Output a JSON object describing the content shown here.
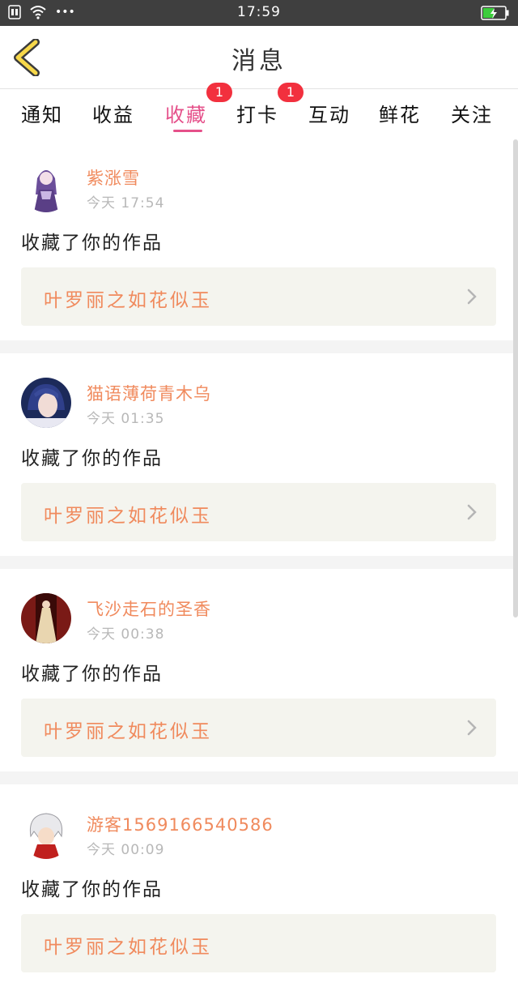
{
  "status_bar": {
    "time": "17:59",
    "dots": "•••"
  },
  "header": {
    "title": "消息"
  },
  "tabs": [
    {
      "label": "通知",
      "active": false,
      "badge": null
    },
    {
      "label": "收益",
      "active": false,
      "badge": null
    },
    {
      "label": "收藏",
      "active": true,
      "badge": "1"
    },
    {
      "label": "打卡",
      "active": false,
      "badge": "1"
    },
    {
      "label": "互动",
      "active": false,
      "badge": null
    },
    {
      "label": "鲜花",
      "active": false,
      "badge": null
    },
    {
      "label": "关注",
      "active": false,
      "badge": null
    }
  ],
  "feed": [
    {
      "user": "紫涨雪",
      "time": "今天 17:54",
      "action": "收藏了你的作品",
      "work": "叶罗丽之如花似玉",
      "avatar": "purple-doll-avatar"
    },
    {
      "user": "猫语薄荷青木乌",
      "time": "今天 01:35",
      "action": "收藏了你的作品",
      "work": "叶罗丽之如花似玉",
      "avatar": "blue-hair-avatar"
    },
    {
      "user": "飞沙走石的圣香",
      "time": "今天 00:38",
      "action": "收藏了你的作品",
      "work": "叶罗丽之如花似玉",
      "avatar": "gown-avatar"
    },
    {
      "user": "游客1569166540586",
      "time": "今天 00:09",
      "action": "收藏了你的作品",
      "work": "叶罗丽之如花似玉",
      "avatar": "white-hair-avatar"
    }
  ],
  "colors": {
    "accent": "#e5508a",
    "name": "#f08a5d",
    "badge": "#f2303e",
    "battery": "#3ccd3c"
  }
}
